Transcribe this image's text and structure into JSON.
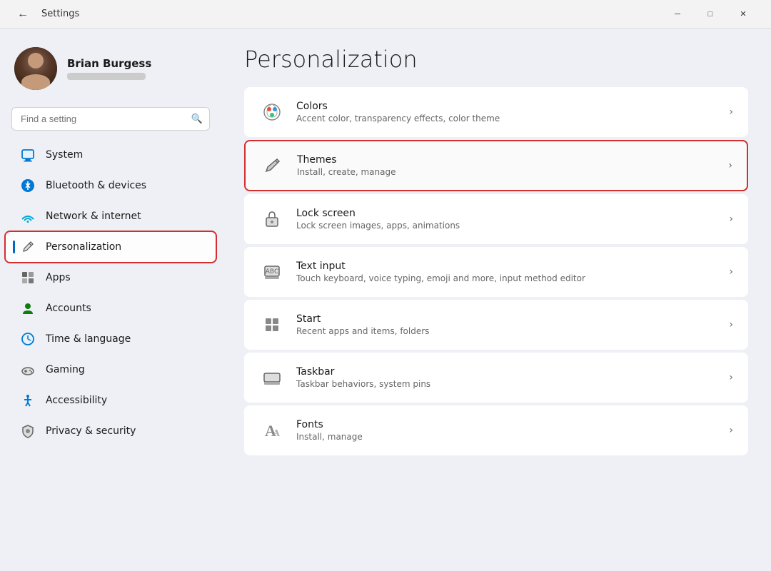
{
  "titleBar": {
    "title": "Settings",
    "minimize": "─",
    "maximize": "□",
    "close": "✕"
  },
  "user": {
    "name": "Brian Burgess",
    "email_placeholder": "email hidden"
  },
  "search": {
    "placeholder": "Find a setting"
  },
  "nav": {
    "items": [
      {
        "id": "system",
        "label": "System",
        "icon": "system"
      },
      {
        "id": "bluetooth",
        "label": "Bluetooth & devices",
        "icon": "bluetooth"
      },
      {
        "id": "network",
        "label": "Network & internet",
        "icon": "network"
      },
      {
        "id": "personalization",
        "label": "Personalization",
        "icon": "personalization",
        "active": true
      },
      {
        "id": "apps",
        "label": "Apps",
        "icon": "apps"
      },
      {
        "id": "accounts",
        "label": "Accounts",
        "icon": "accounts"
      },
      {
        "id": "time",
        "label": "Time & language",
        "icon": "time"
      },
      {
        "id": "gaming",
        "label": "Gaming",
        "icon": "gaming"
      },
      {
        "id": "accessibility",
        "label": "Accessibility",
        "icon": "accessibility"
      },
      {
        "id": "privacy",
        "label": "Privacy & security",
        "icon": "privacy"
      }
    ]
  },
  "main": {
    "title": "Personalization",
    "settings": [
      {
        "id": "colors",
        "title": "Colors",
        "desc": "Accent color, transparency effects, color theme",
        "icon": "colors"
      },
      {
        "id": "themes",
        "title": "Themes",
        "desc": "Install, create, manage",
        "icon": "themes",
        "highlighted": true
      },
      {
        "id": "lock-screen",
        "title": "Lock screen",
        "desc": "Lock screen images, apps, animations",
        "icon": "lock-screen"
      },
      {
        "id": "text-input",
        "title": "Text input",
        "desc": "Touch keyboard, voice typing, emoji and more, input method editor",
        "icon": "text-input"
      },
      {
        "id": "start",
        "title": "Start",
        "desc": "Recent apps and items, folders",
        "icon": "start"
      },
      {
        "id": "taskbar",
        "title": "Taskbar",
        "desc": "Taskbar behaviors, system pins",
        "icon": "taskbar"
      },
      {
        "id": "fonts",
        "title": "Fonts",
        "desc": "Install, manage",
        "icon": "fonts"
      }
    ]
  }
}
